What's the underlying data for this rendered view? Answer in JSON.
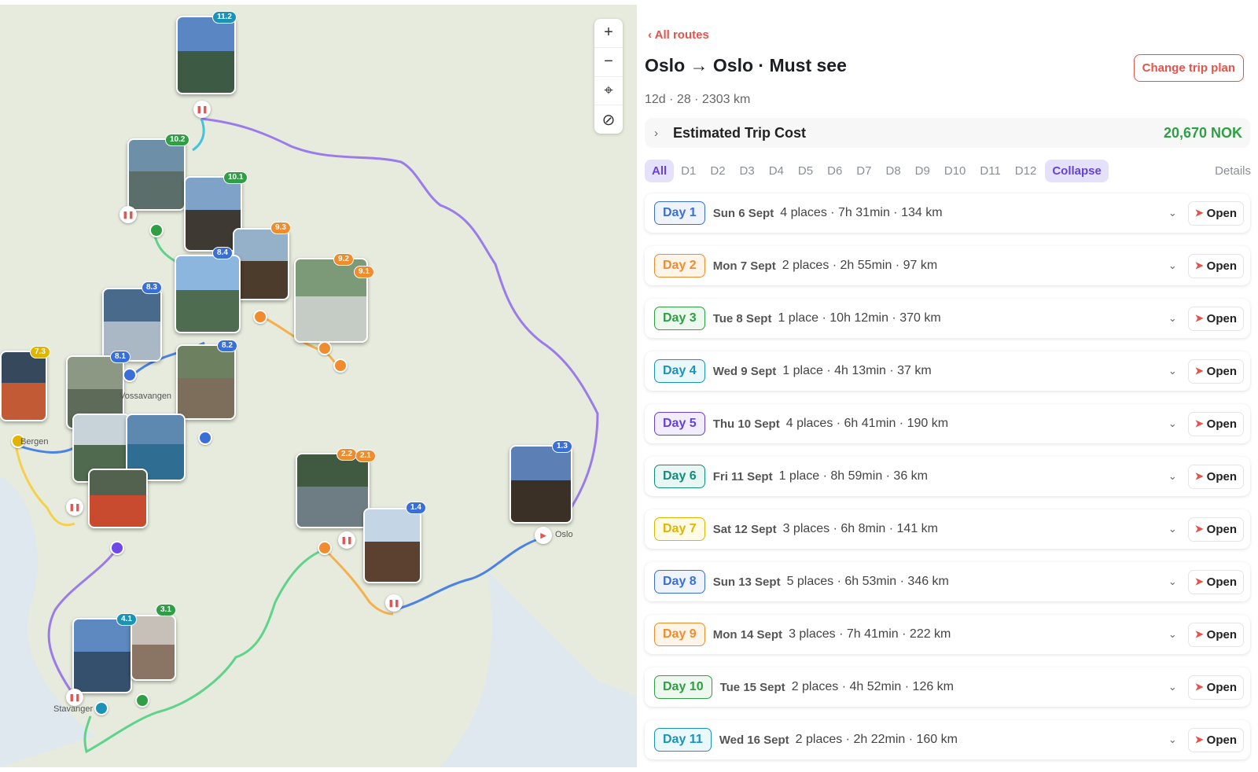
{
  "map": {
    "labels": {
      "bergen": "Bergen",
      "vossavangen": "Vossavangen",
      "stavanger": "Stavanger",
      "oslo": "Oslo"
    },
    "zoom": {
      "plus": "+",
      "minus": "−"
    },
    "badges": [
      "11.2",
      "10.2",
      "10.1",
      "9.3",
      "9.2",
      "9.1",
      "8.4",
      "8.3",
      "8.2",
      "8.1",
      "7.3",
      "1.3",
      "2.2",
      "2.1",
      "1.4",
      "4.1",
      "3.1"
    ]
  },
  "panel": {
    "back_label": "All routes",
    "title": "Oslo → Oslo · Must see",
    "change_label": "Change trip plan",
    "meta": "12d · 28 · 2303 km",
    "cost_label": "Estimated Trip Cost",
    "cost_value": "20,670 NOK",
    "tabs": [
      "All",
      "D1",
      "D2",
      "D3",
      "D4",
      "D5",
      "D6",
      "D7",
      "D8",
      "D9",
      "D10",
      "D11",
      "D12"
    ],
    "collapse_label": "Collapse",
    "details_label": "Details",
    "open_label": "Open",
    "days": [
      {
        "label": "Day 1",
        "date": "Sun 6 Sept",
        "info": "4 places · 7h 31min · 134 km",
        "color": "#3b6fd8",
        "bg": "#eef3fe"
      },
      {
        "label": "Day 2",
        "date": "Mon 7 Sept",
        "info": "2 places · 2h 55min · 97 km",
        "color": "#f08c2e",
        "bg": "#fff4e8"
      },
      {
        "label": "Day 3",
        "date": "Tue 8 Sept",
        "info": "1 place · 10h 12min · 370 km",
        "color": "#2f9e44",
        "bg": "#edf9ef"
      },
      {
        "label": "Day 4",
        "date": "Wed 9 Sept",
        "info": "1 place · 4h 13min · 37 km",
        "color": "#1a93b7",
        "bg": "#eaf7fb"
      },
      {
        "label": "Day 5",
        "date": "Thu 10 Sept",
        "info": "4 places · 6h 41min · 190 km",
        "color": "#6741d9",
        "bg": "#f1edfd"
      },
      {
        "label": "Day 6",
        "date": "Fri 11 Sept",
        "info": "1 place · 8h 59min · 36 km",
        "color": "#0f8e7a",
        "bg": "#e8f7f4"
      },
      {
        "label": "Day 7",
        "date": "Sat 12 Sept",
        "info": "3 places · 6h 8min · 141 km",
        "color": "#e0b400",
        "bg": "#fffbe6"
      },
      {
        "label": "Day 8",
        "date": "Sun 13 Sept",
        "info": "5 places · 6h 53min · 346 km",
        "color": "#3b6fd8",
        "bg": "#eef3fe"
      },
      {
        "label": "Day 9",
        "date": "Mon 14 Sept",
        "info": "3 places · 7h 41min · 222 km",
        "color": "#f08c2e",
        "bg": "#fff4e8"
      },
      {
        "label": "Day 10",
        "date": "Tue 15 Sept",
        "info": "2 places · 4h 52min · 126 km",
        "color": "#2f9e44",
        "bg": "#edf9ef"
      },
      {
        "label": "Day 11",
        "date": "Wed 16 Sept",
        "info": "2 places · 2h 22min · 160 km",
        "color": "#1a93b7",
        "bg": "#eaf7fb"
      }
    ]
  }
}
